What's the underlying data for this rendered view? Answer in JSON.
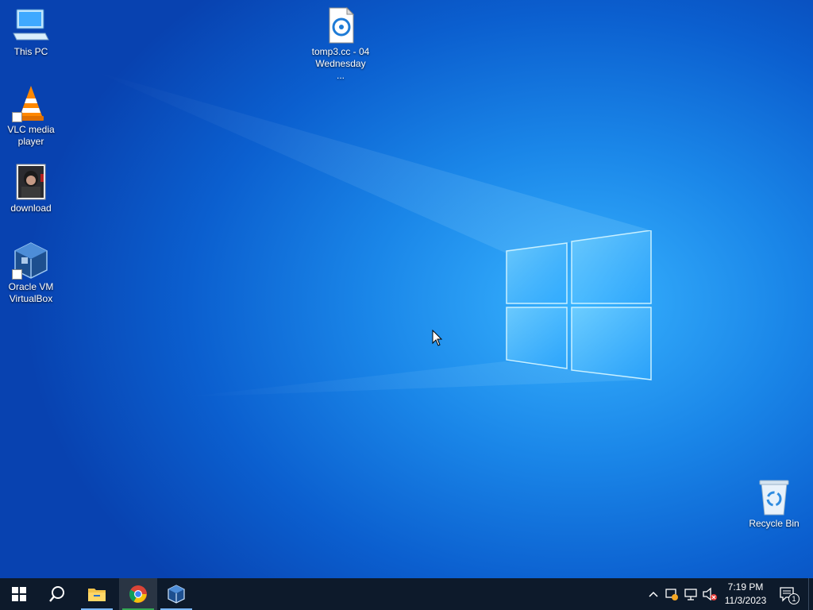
{
  "desktop": {
    "icons": [
      {
        "label": "This PC",
        "icon": "this-pc-icon"
      },
      {
        "label": "VLC media player",
        "icon": "vlc-icon"
      },
      {
        "label": "download",
        "icon": "image-file-icon"
      },
      {
        "label": "Oracle VM VirtualBox",
        "icon": "virtualbox-icon"
      },
      {
        "label": "tomp3.cc - 04 Wednesday ...",
        "icon": "audio-file-icon"
      },
      {
        "label": "Recycle Bin",
        "icon": "recycle-bin-icon"
      }
    ]
  },
  "taskbar": {
    "buttons": [
      {
        "name": "start",
        "icon": "windows-start-icon"
      },
      {
        "name": "search",
        "icon": "search-icon"
      },
      {
        "name": "file-explorer",
        "icon": "folder-icon"
      },
      {
        "name": "chrome",
        "icon": "chrome-icon"
      },
      {
        "name": "virtualbox",
        "icon": "virtualbox-icon"
      }
    ],
    "tray": {
      "time": "7:19 PM",
      "date": "11/3/2023",
      "notification_count": "1"
    }
  },
  "colors": {
    "taskbar": "#0d1a2b",
    "accent": "#7ab8ff",
    "chrome_active": "#34a853"
  }
}
